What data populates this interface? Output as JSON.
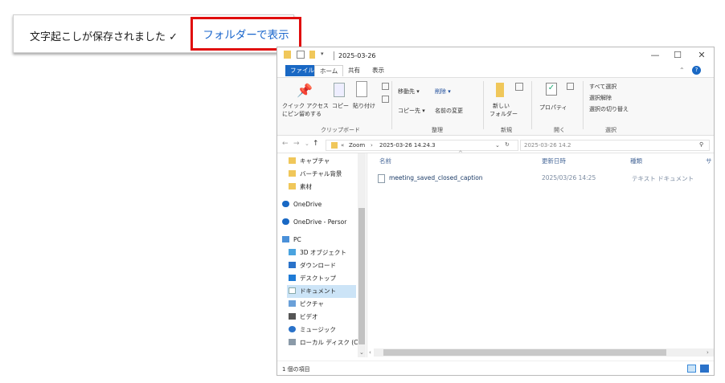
{
  "notification": {
    "message": "文字起こしが保存されました ✓",
    "button_label": "フォルダーで表示",
    "highlight_color": "#e00d0d",
    "link_color": "#1a66cc"
  },
  "window": {
    "title": "2025-03-26",
    "minimize": "—",
    "maximize": "☐",
    "close": "✕"
  },
  "menu": {
    "file": "ファイル",
    "home": "ホーム",
    "share": "共有",
    "view": "表示",
    "accent": "#1968c4"
  },
  "ribbon": {
    "pin_label_1": "クイック アクセス",
    "pin_label_2": "にピン留めする",
    "copy": "コピー",
    "paste": "貼り付け",
    "move_to": "移動先 ▾",
    "delete": "削除 ▾",
    "copy_to": "コピー先 ▾",
    "rename": "名前の変更",
    "new_folder_1": "新しい",
    "new_folder_2": "フォルダー",
    "properties": "プロパティ",
    "select_all": "すべて選択",
    "select_none": "選択解除",
    "invert_selection": "選択の切り替え",
    "group_clipboard": "クリップボード",
    "group_organize": "整理",
    "group_new": "新規",
    "group_open": "開く",
    "group_select": "選択"
  },
  "address": {
    "path_zoom": "Zoom",
    "path_date": "2025-03-26 14.24.3",
    "search_placeholder": "2025-03-26 14.2"
  },
  "nav_items": [
    {
      "label": "キャプチャ",
      "icon": "folder-icon"
    },
    {
      "label": "バーチャル背景",
      "icon": "folder-icon"
    },
    {
      "label": "素材",
      "icon": "folder-icon"
    },
    {
      "label": "OneDrive",
      "icon": "cloud-icon"
    },
    {
      "label": "OneDrive - Persor",
      "icon": "cloud-icon"
    },
    {
      "label": "PC",
      "icon": "pc-icon"
    },
    {
      "label": "3D オブジェクト",
      "icon": "cube-icon"
    },
    {
      "label": "ダウンロード",
      "icon": "download-icon"
    },
    {
      "label": "デスクトップ",
      "icon": "desktop-icon"
    },
    {
      "label": "ドキュメント",
      "icon": "document-icon"
    },
    {
      "label": "ピクチャ",
      "icon": "picture-icon"
    },
    {
      "label": "ビデオ",
      "icon": "video-icon"
    },
    {
      "label": "ミュージック",
      "icon": "music-icon"
    },
    {
      "label": "ローカル ディスク (C",
      "icon": "disk-icon"
    }
  ],
  "columns": {
    "name": "名前",
    "date": "更新日時",
    "type": "種類",
    "size": "サ"
  },
  "files": [
    {
      "name": "meeting_saved_closed_caption",
      "date": "2025/03/26 14:25",
      "type": "テキスト ドキュメント"
    }
  ],
  "status": {
    "item_count": "1 個の項目"
  }
}
